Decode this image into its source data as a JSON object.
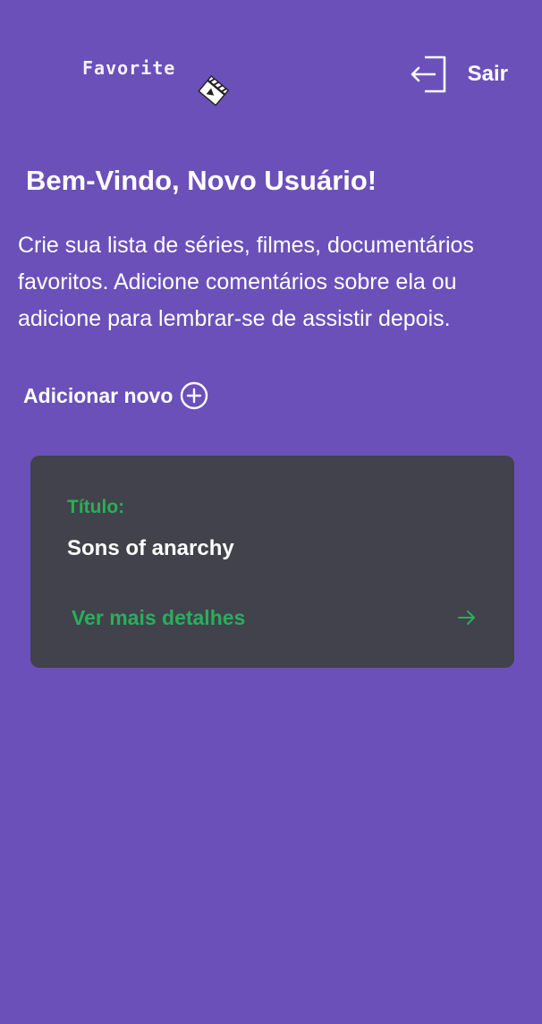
{
  "header": {
    "logo_text": "Favorite",
    "logo_icon": "clapperboard-icon",
    "logout_icon": "logout-icon",
    "logout_label": "Sair"
  },
  "welcome": {
    "title": "Bem-Vindo, Novo Usuário!",
    "description": "Crie sua lista de séries, filmes, documentários favoritos. Adicione comentários sobre ela ou adicione para lembrar-se de assistir depois."
  },
  "add_new": {
    "label": "Adicionar novo",
    "icon": "plus-circle-icon"
  },
  "items": [
    {
      "label": "Título:",
      "title": "Sons of anarchy",
      "details_label": "Ver mais detalhes",
      "details_icon": "arrow-right-icon"
    }
  ],
  "colors": {
    "background": "#6b50ba",
    "card": "#41424b",
    "accent_green": "#27b05a",
    "text": "#ffffff"
  }
}
